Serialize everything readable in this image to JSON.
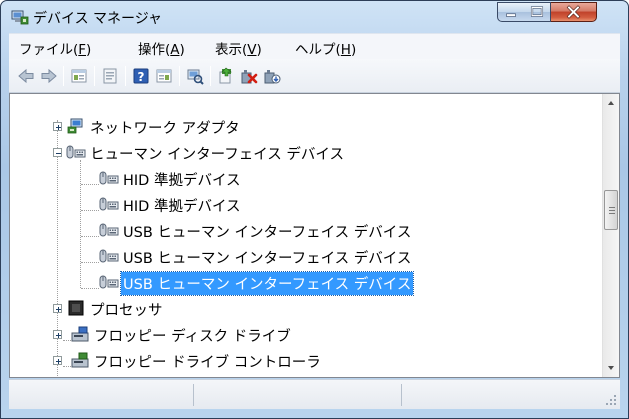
{
  "window": {
    "title": "デバイス マネージャ",
    "title_icon": "device-manager-icon",
    "caption_buttons": [
      "minimize",
      "maximize",
      "close"
    ]
  },
  "menu": {
    "items": [
      {
        "label": "ファイル(",
        "key": "F",
        "tail": ")"
      },
      {
        "label": "操作(",
        "key": "A",
        "tail": ")"
      },
      {
        "label": "表示(",
        "key": "V",
        "tail": ")"
      },
      {
        "label": "ヘルプ(",
        "key": "H",
        "tail": ")"
      }
    ]
  },
  "toolbar": {
    "buttons": [
      "back-arrow-icon",
      "forward-arrow-icon",
      "show-hide-console-tree-icon",
      "properties-icon",
      "help-icon",
      "view-icon",
      "scan-hardware-icon",
      "update-driver-icon",
      "disable-device-icon",
      "uninstall-device-icon"
    ]
  },
  "tree": {
    "items": [
      {
        "label": "ネットワーク アダプタ",
        "icon": "network-adapter-icon",
        "expander": "+"
      },
      {
        "label": "ヒューマン インターフェイス デバイス",
        "icon": "hid-icon",
        "expander": "-"
      },
      {
        "label": "HID 準拠デバイス",
        "icon": "hid-icon"
      },
      {
        "label": "HID 準拠デバイス",
        "icon": "hid-icon"
      },
      {
        "label": "USB ヒューマン インターフェイス デバイス",
        "icon": "hid-icon"
      },
      {
        "label": "USB ヒューマン インターフェイス デバイス",
        "icon": "hid-icon"
      },
      {
        "label": "USB ヒューマン インターフェイス デバイス",
        "icon": "hid-icon",
        "selected": true
      },
      {
        "label": "プロセッサ",
        "icon": "processor-icon",
        "expander": "+"
      },
      {
        "label": "フロッピー ディスク ドライブ",
        "icon": "floppy-disk-drive-icon",
        "expander": "+"
      },
      {
        "label": "フロッピー ドライブ コントローラ",
        "icon": "floppy-controller-icon",
        "expander": "+"
      }
    ],
    "scrollbar": {
      "position_fraction": 0.42
    }
  },
  "status": {
    "panes": [
      "",
      "",
      ""
    ]
  },
  "colors": {
    "selection": "#3399ff",
    "close_button": "#c0412a",
    "frame": "#b8d1ec"
  }
}
